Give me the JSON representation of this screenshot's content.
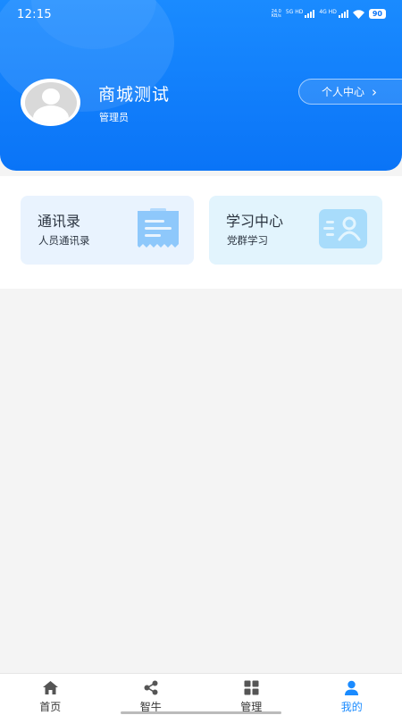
{
  "status_bar": {
    "time": "12:15",
    "net_speed_value": "24.0",
    "net_speed_unit": "KB/s",
    "sim1_label": "5G HD",
    "sim2_label": "4G HD",
    "battery": "90"
  },
  "profile": {
    "name": "商城测试",
    "role": "管理员",
    "personal_center_label": "个人中心",
    "personal_center_arrow": "›"
  },
  "cards": [
    {
      "title": "通讯录",
      "subtitle": "人员通讯录",
      "icon": "contacts-note-icon"
    },
    {
      "title": "学习中心",
      "subtitle": "党群学习",
      "icon": "id-card-icon"
    }
  ],
  "tabbar": {
    "items": [
      {
        "label": "首页",
        "icon": "home-icon"
      },
      {
        "label": "智牛",
        "icon": "share-icon"
      },
      {
        "label": "管理",
        "icon": "grid-icon"
      },
      {
        "label": "我的",
        "icon": "user-icon"
      }
    ],
    "active_index": 3
  },
  "colors": {
    "primary": "#0a74f7",
    "active_tab": "#1a8bff",
    "card_icon": "#8ec8fb"
  }
}
